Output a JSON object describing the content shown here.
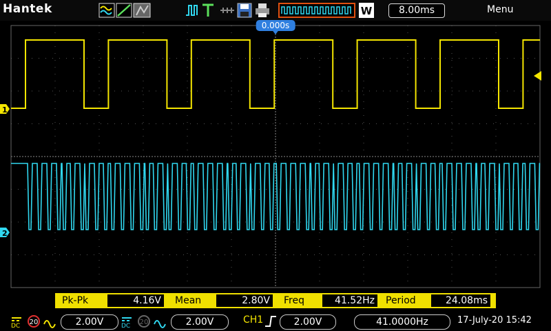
{
  "brand": "Hantek",
  "timebase": "8.00ms",
  "menu_label": "Menu",
  "trigger_time": "0.000s",
  "run_mode": "W",
  "channels": {
    "ch1": {
      "marker": "1",
      "color": "#f5e600"
    },
    "ch2": {
      "marker": "2",
      "color": "#30d8f0"
    }
  },
  "measurements": [
    {
      "label": "Pk-Pk",
      "value": "4.16V"
    },
    {
      "label": "Mean",
      "value": "2.80V"
    },
    {
      "label": "Freq",
      "value": "41.52Hz"
    },
    {
      "label": "Period",
      "value": "24.08ms"
    }
  ],
  "status": {
    "ch1_scale": "2.00V",
    "ch2_scale": "2.00V",
    "bw_label": "20",
    "trigger_source": "CH1",
    "trigger_level": "2.00V",
    "frequency": "41.0000Hz",
    "datetime": "17-July-20 15:42"
  },
  "icons": {
    "waveform_modes": "waveform-mode-icons",
    "trigger": "trigger-icon",
    "save": "save-icon",
    "print": "print-icon",
    "rising_edge": "rising-edge-icon"
  }
}
